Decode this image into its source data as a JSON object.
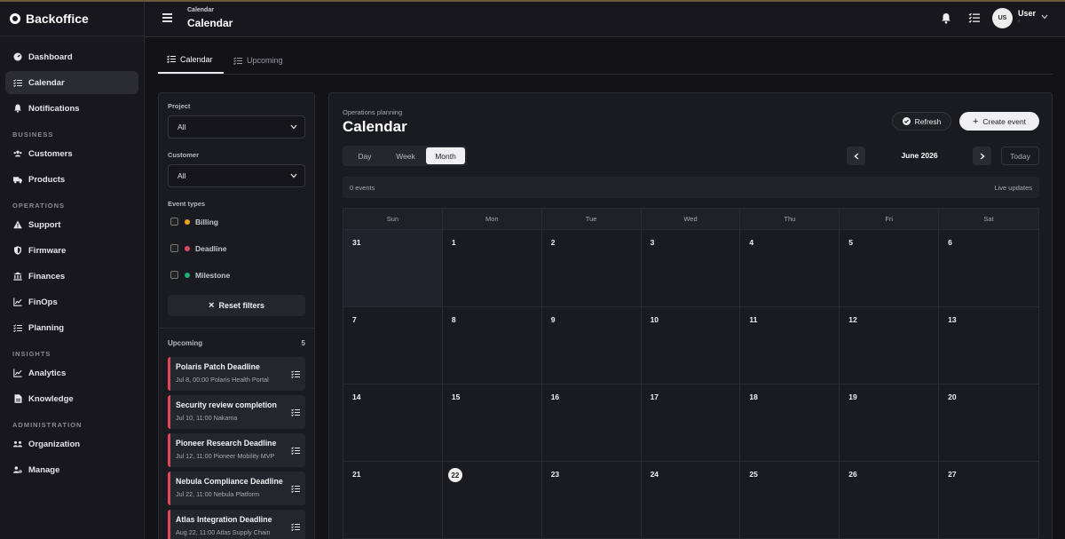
{
  "brand": "Backoffice",
  "sidebar": {
    "items_top": [
      {
        "label": "Dashboard",
        "icon": "dashboard-icon"
      },
      {
        "label": "Calendar",
        "icon": "checklist-icon",
        "active": true
      },
      {
        "label": "Notifications",
        "icon": "bell-icon"
      }
    ],
    "section_business": "BUSINESS",
    "items_business": [
      {
        "label": "Customers",
        "icon": "users-icon"
      },
      {
        "label": "Products",
        "icon": "truck-icon"
      }
    ],
    "section_operations": "OPERATIONS",
    "items_operations": [
      {
        "label": "Support",
        "icon": "warning-icon"
      },
      {
        "label": "Firmware",
        "icon": "shield-icon"
      },
      {
        "label": "Finances",
        "icon": "bank-icon"
      },
      {
        "label": "FinOps",
        "icon": "chart-line-icon"
      },
      {
        "label": "Planning",
        "icon": "checklist-icon"
      }
    ],
    "section_insights": "INSIGHTS",
    "items_insights": [
      {
        "label": "Analytics",
        "icon": "chart-line-icon"
      },
      {
        "label": "Knowledge",
        "icon": "document-icon"
      }
    ],
    "section_admin": "ADMINISTRATION",
    "items_admin": [
      {
        "label": "Organization",
        "icon": "org-icon"
      },
      {
        "label": "Manage",
        "icon": "user-gear-icon"
      }
    ]
  },
  "header": {
    "breadcrumb": "Calendar",
    "title": "Calendar",
    "avatar_initials": "US",
    "user_name": "User",
    "user_sub": "-"
  },
  "tabs": {
    "calendar": "Calendar",
    "upcoming": "Upcoming"
  },
  "filters": {
    "project_label": "Project",
    "project_value": "All",
    "customer_label": "Customer",
    "customer_value": "All",
    "event_types_label": "Event types",
    "event_types": [
      {
        "label": "Billing",
        "color": "#e8a317"
      },
      {
        "label": "Deadline",
        "color": "#e0475b"
      },
      {
        "label": "Milestone",
        "color": "#20b07a"
      }
    ],
    "reset_label": "Reset filters",
    "upcoming_label": "Upcoming",
    "upcoming_count": "5",
    "upcoming_items": [
      {
        "title": "Polaris Patch Deadline",
        "meta": "Jul 8, 00:00  Polaris Health Portal"
      },
      {
        "title": "Security review completion",
        "meta": "Jul 10, 11:00  Nakama"
      },
      {
        "title": "Pioneer Research Deadline",
        "meta": "Jul 12, 11:00  Pioneer Mobility MVP"
      },
      {
        "title": "Nebula Compliance Deadline",
        "meta": "Jul 22, 11:00  Nebula Platform"
      },
      {
        "title": "Atlas Integration Deadline",
        "meta": "Aug 22, 11:00  Atlas Supply Chain"
      }
    ]
  },
  "calendar": {
    "subtitle": "Operations planning",
    "title": "Calendar",
    "refresh_label": "Refresh",
    "create_label": "Create event",
    "views": [
      "Day",
      "Week",
      "Month"
    ],
    "active_view": "Month",
    "month_label": "June 2026",
    "today_label": "Today",
    "events_count": "0 events",
    "live_label": "Live updates",
    "weekdays": [
      "Sun",
      "Mon",
      "Tue",
      "Wed",
      "Thu",
      "Fri",
      "Sat"
    ],
    "weeks": [
      [
        "31",
        "1",
        "2",
        "3",
        "4",
        "5",
        "6"
      ],
      [
        "7",
        "8",
        "9",
        "10",
        "11",
        "12",
        "13"
      ],
      [
        "14",
        "15",
        "16",
        "17",
        "18",
        "19",
        "20"
      ],
      [
        "21",
        "22",
        "23",
        "24",
        "25",
        "26",
        "27"
      ]
    ],
    "today": "22"
  }
}
